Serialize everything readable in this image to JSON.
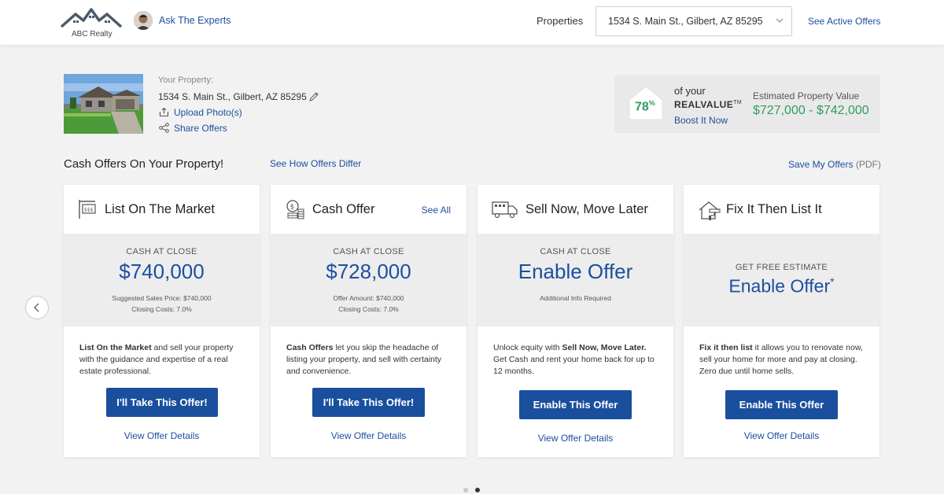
{
  "header": {
    "logo_text": "ABC Realty",
    "expert_link": "Ask The Experts",
    "properties_label": "Properties",
    "property_select": "1534 S. Main St., Gilbert, AZ 85295",
    "see_active": "See Active Offers"
  },
  "property": {
    "label": "Your Property:",
    "address": "1534 S. Main St., Gilbert, AZ 85295",
    "upload": "Upload Photo(s)",
    "share": "Share Offers"
  },
  "realvalue": {
    "percent": "78",
    "percent_sign": "%",
    "of_your": "of your",
    "brand": "REALVALUE",
    "tm": "TM",
    "boost": "Boost It Now",
    "est_label": "Estimated Property Value",
    "est_value": "$727,000 - $742,000"
  },
  "section": {
    "title": "Cash Offers On Your Property!",
    "see_how": "See How Offers Differ",
    "save": "Save My Offers",
    "save_suffix": "(PDF)"
  },
  "cards": [
    {
      "title": "List On The Market",
      "label": "CASH AT CLOSE",
      "value": "$740,000",
      "small1": "Suggested Sales Price: $740,000",
      "small2": "Closing Costs: 7.0%",
      "desc_bold": "List On the Market",
      "desc_rest": " and sell your property with the guidance and expertise of a real estate professional.",
      "button": "I'll Take This Offer!",
      "link": "View Offer Details"
    },
    {
      "title": "Cash Offer",
      "see_all": "See All",
      "label": "CASH AT CLOSE",
      "value": "$728,000",
      "small1": "Offer Amount: $740,000",
      "small2": "Closing Costs: 7.0%",
      "desc_bold": "Cash Offers",
      "desc_rest": " let you skip the headache of listing your property, and sell with certainty and convenience.",
      "button": "I'll Take This Offer!",
      "link": "View Offer Details"
    },
    {
      "title": "Sell Now, Move Later",
      "label": "CASH AT CLOSE",
      "value": "Enable Offer",
      "small1": "Additional Info Required",
      "desc_pre": "Unlock equity with ",
      "desc_bold": "Sell Now, Move Later.",
      "desc_rest": " Get Cash and rent your home back for up to 12 months.",
      "button": "Enable This Offer",
      "link": "View Offer Details"
    },
    {
      "title": "Fix It Then List It",
      "label": "GET FREE ESTIMATE",
      "value": "Enable Offer",
      "value_mark": "*",
      "desc_bold": "Fix it then list",
      "desc_rest": " it allows you to renovate now, sell your home for more and pay at closing. Zero due until home sells.",
      "button": "Enable This Offer",
      "link": "View Offer Details"
    }
  ],
  "colors": {
    "brand_blue": "#1a4f9e",
    "link_blue": "#1d4fa0",
    "accent_green": "#2e9e5b"
  }
}
